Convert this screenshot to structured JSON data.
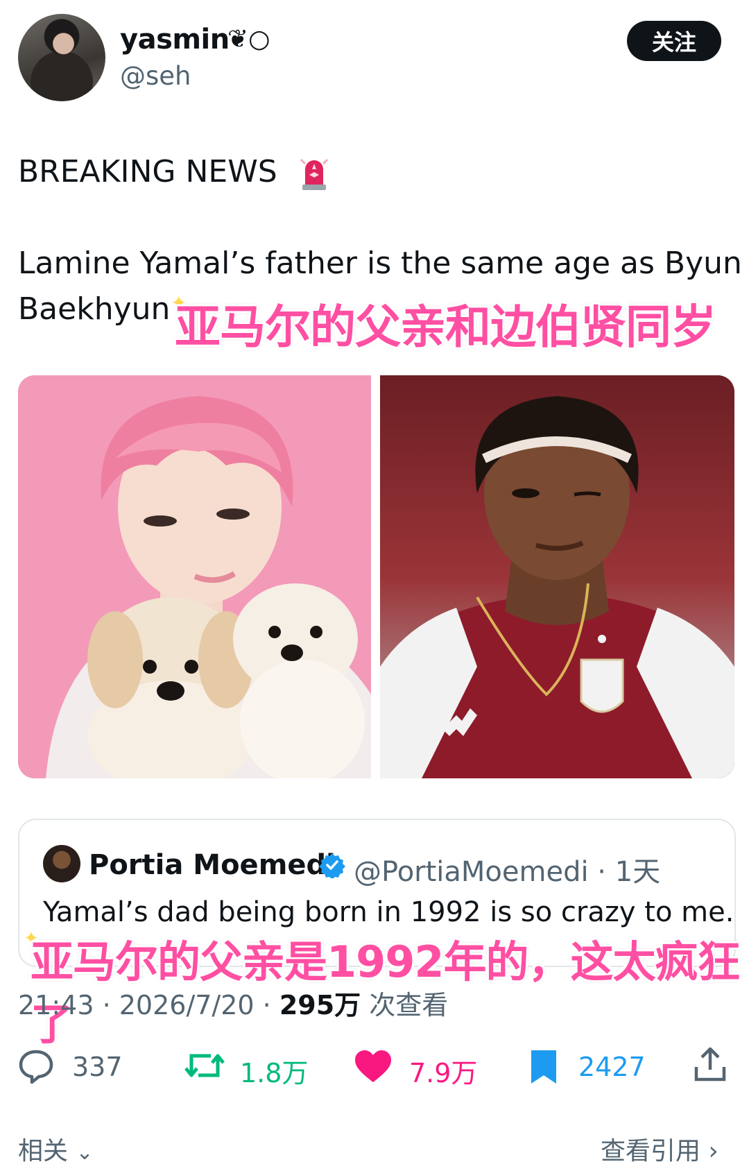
{
  "author": {
    "name": "yasmin",
    "emoji": "❦○",
    "handle": "@seh"
  },
  "follow_label": "关注",
  "tweet": {
    "headline": "BREAKING NEWS",
    "body_line1": "Lamine Yamal’s father is the same age as Byun",
    "body_line2": "Baekhyun",
    "caption_cn": "亚马尔的父亲和边伯贤同岁"
  },
  "quoted": {
    "name": "Portia Moemedi",
    "handle": "@PortiaMoemedi · 1天",
    "text": "Yamal’s dad being born in 1992 is so crazy to me.",
    "caption_cn": "亚马尔的父亲是1992年的，这太疯狂了"
  },
  "meta": {
    "time_date": "21:43 · 2026/7/20 · ",
    "views": "295万",
    "views_label": " 次查看"
  },
  "actions": {
    "replies": "337",
    "reposts": "1.8万",
    "likes": "7.9万",
    "bookmarks": "2427"
  },
  "colors": {
    "repost": "#00ba7c",
    "like": "#f91880",
    "bookmark": "#1d9bf0",
    "caption": "#ff4fa3"
  },
  "footer": {
    "related": "相关",
    "view_quotes": "查看引用"
  }
}
